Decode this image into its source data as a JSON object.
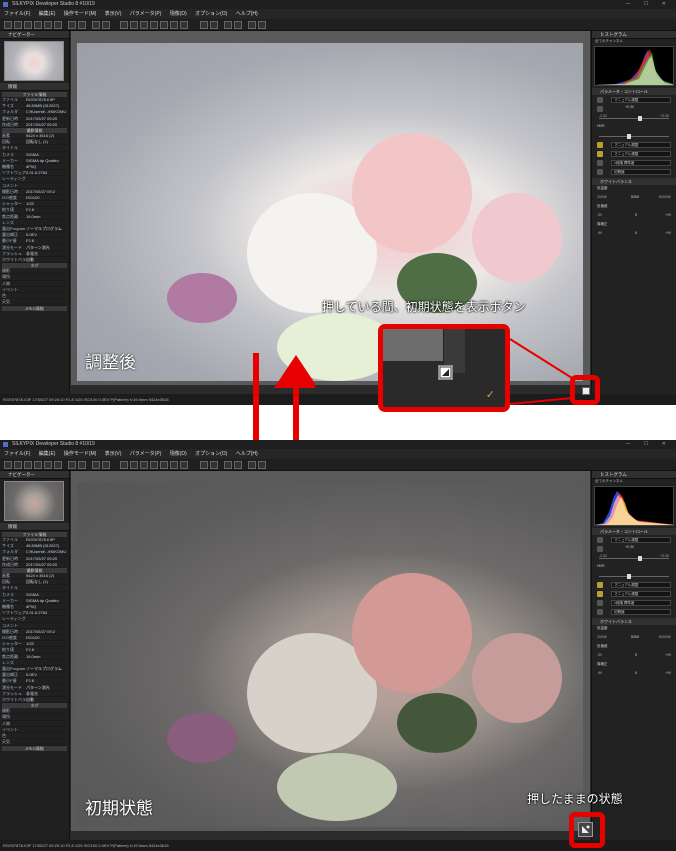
{
  "app": {
    "window_title": "SILKYPIX Developer Studio 8 #10/19",
    "menu": [
      "ファイル(F)",
      "編集(E)",
      "操作モード(M)",
      "表示(V)",
      "パラメータ(P)",
      "現像(D)",
      "オプション(O)",
      "ヘルプ(H)"
    ]
  },
  "left_panel": {
    "navigator_title": "ナビゲーター",
    "info_title": "情報",
    "file_section": "ファイル情報",
    "camera_section": "撮影情報",
    "info_rows": [
      {
        "k": "ファイル",
        "v": "RGS97878.KSP"
      },
      {
        "k": "サイズ",
        "v": "48.83MB (512027)"
      },
      {
        "k": "フォルダ",
        "v": "C:¥Users¥...¥SIKOMU"
      },
      {
        "k": "更新日時",
        "v": "2017/05/27 09:20"
      },
      {
        "k": "作成日時",
        "v": "2017/05/27 09:20"
      }
    ],
    "shooting_rows": [
      {
        "k": "画素",
        "v": "5424 x 3616 (2)"
      },
      {
        "k": "回転",
        "v": "回転なし (1)"
      },
      {
        "k": "タイトル",
        "v": ""
      },
      {
        "k": "カメラ",
        "v": "SIGMA"
      },
      {
        "k": "メーカー",
        "v": "SIGMA dp Quattro"
      },
      {
        "k": "機種名",
        "v": "dP0Q"
      },
      {
        "k": "ソフトウェア",
        "v": "2.01.6.2784"
      },
      {
        "k": "レーティング",
        "v": ""
      },
      {
        "k": "コメント",
        "v": ""
      }
    ],
    "exposure_rows": [
      {
        "k": "撮影日時",
        "v": "2017/05/27 09:2"
      },
      {
        "k": "ISO感度",
        "v": "ISO100"
      },
      {
        "k": "シャッター",
        "v": "1/25"
      },
      {
        "k": "絞り値",
        "v": "F2.8"
      },
      {
        "k": "焦点距離",
        "v": "19.0mm"
      },
      {
        "k": "レンズ",
        "v": ""
      },
      {
        "k": "露出Program",
        "v": "ノーマルプログラム"
      },
      {
        "k": "露出補正",
        "v": "0.0EV"
      },
      {
        "k": "最小F値",
        "v": "F2.8"
      },
      {
        "k": "測光モード",
        "v": "パターン測光"
      },
      {
        "k": "フラッシュ",
        "v": "非発光"
      },
      {
        "k": "ホワイトバランス",
        "v": "自動"
      }
    ],
    "tag_section": "タグ",
    "tag_rows": [
      "撮影",
      "場所",
      "人物",
      "イベント",
      "色",
      "天気"
    ],
    "jpeg_section": "JPEG情報"
  },
  "screenshots": {
    "top": {
      "caption": "調整後",
      "status": "RGS97878.X3F 17/05/27 09:20:10 F2.8 1/25 ISO100 0.0EV P(Pattern) f=19.0mm 5424x3616",
      "photo_tint": "#ece8e6"
    },
    "bottom": {
      "window_title": "SILKYPIX Developer Studio 8  #10/19",
      "caption": "初期状態",
      "status": "RGS97878.X3F 17/05/27 09:20:10 F2.8 1/25 ISO100 0.0EV P(Pattern) f=19.0mm 5424x3616",
      "photo_tint": "#9c938c"
    }
  },
  "right_panel": {
    "histogram_title": "ヒストグラム",
    "histogram_channel": "全てのチャンネル",
    "control_title": "パラメータ・コントロール",
    "tone_preset": "マニュアル調整",
    "exposure_values": [
      "-2.00",
      "+0.30",
      "+2.00"
    ],
    "hdr_label": "HDR",
    "color_preset": "マニュアル調整",
    "wb_preset": "マニュアル調整",
    "sharp_preset": "1段階 標準度",
    "nr_preset": "初期値",
    "wb_title": "ホワイトバランス",
    "wb_temp_label": "色温度",
    "wb_temp_values": [
      "2000K",
      "5200",
      "50000K"
    ],
    "wb_tint_label": "色偏差",
    "wb_tint_values": [
      "-99",
      "0",
      "+99"
    ],
    "wb_green_label": "緑補正",
    "wb_green_values": [
      "-99",
      "0",
      "+99"
    ]
  },
  "annotations": {
    "press_hold_label": "押している間、初期状態を表示ボタン",
    "held_state_label": "押したままの状態"
  },
  "colors": {
    "highlight_red": "#e60000",
    "arrow_red": "#e60000",
    "accent_gold": "#c8a040"
  }
}
